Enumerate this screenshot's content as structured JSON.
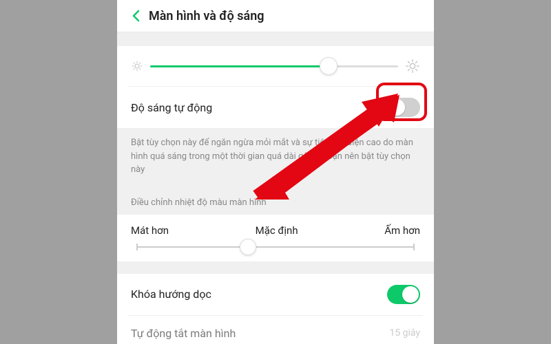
{
  "header": {
    "title": "Màn hình và độ sáng"
  },
  "brightness": {
    "slider_percent": 72
  },
  "auto_brightness": {
    "label": "Độ sáng tự động",
    "enabled": false,
    "description": "Bật tùy chọn này để ngăn ngừa mỏi mắt và sự tiêu thụ điện cao do màn hình quá sáng trong một thời gian quá dài gây ra. Bạn nên bật tùy chọn này"
  },
  "color_temp": {
    "section_label": "Điều chỉnh nhiệt độ màu màn hình",
    "cooler": "Mát hơn",
    "default": "Mặc định",
    "warmer": "Ấm hơn"
  },
  "orientation_lock": {
    "label": "Khóa hướng dọc",
    "enabled": true
  },
  "auto_off": {
    "label": "Tự động tắt màn hình",
    "value": "15 giây"
  },
  "colors": {
    "accent": "#0dc96a",
    "highlight": "#e30613"
  }
}
